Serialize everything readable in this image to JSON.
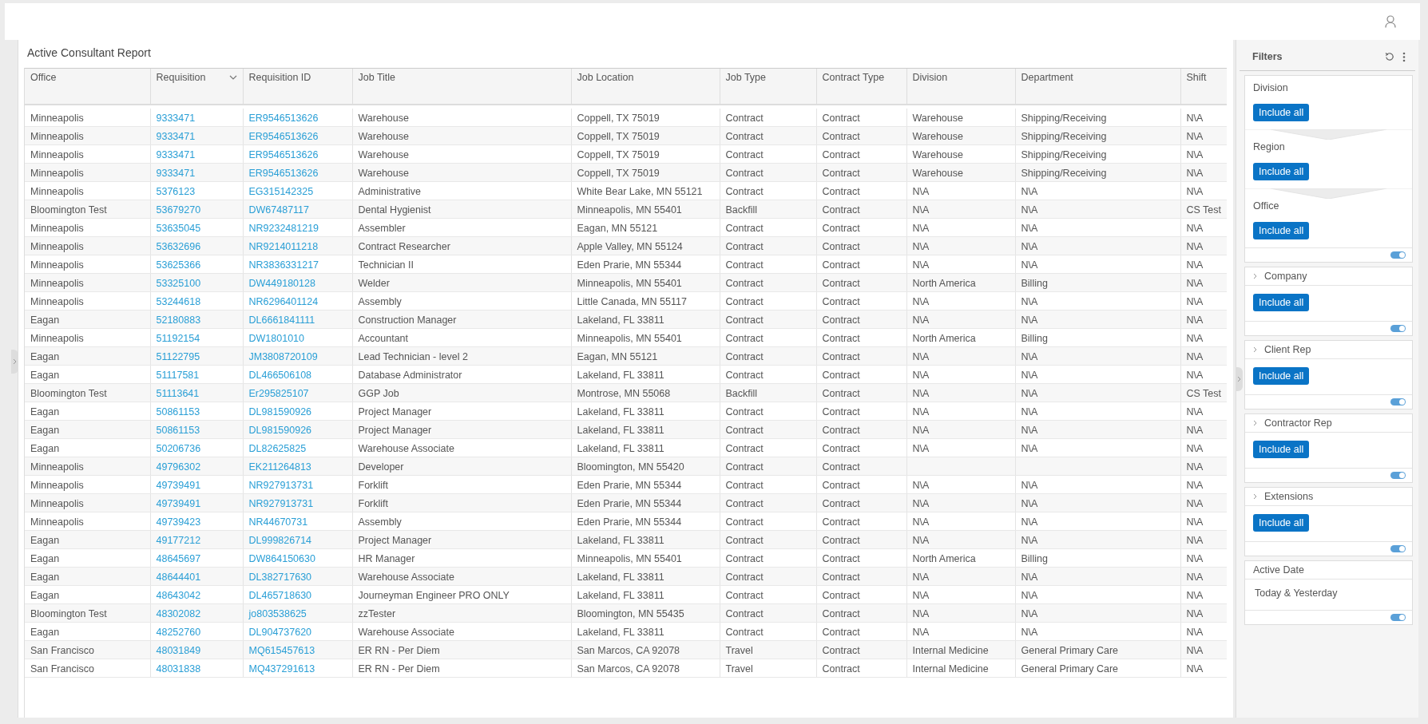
{
  "report": {
    "title": "Active Consultant Report",
    "columns": [
      {
        "label": "Office",
        "kind": "text",
        "sorted": false
      },
      {
        "label": "Requisition",
        "kind": "link",
        "sorted": true
      },
      {
        "label": "Requisition ID",
        "kind": "link",
        "sorted": false
      },
      {
        "label": "Job Title",
        "kind": "text",
        "sorted": false
      },
      {
        "label": "Job Location",
        "kind": "text",
        "sorted": false
      },
      {
        "label": "Job Type",
        "kind": "text",
        "sorted": false
      },
      {
        "label": "Contract Type",
        "kind": "text",
        "sorted": false
      },
      {
        "label": "Division",
        "kind": "text",
        "sorted": false
      },
      {
        "label": "Department",
        "kind": "text",
        "sorted": false
      },
      {
        "label": "Shift",
        "kind": "text",
        "sorted": false
      }
    ],
    "rows": [
      [
        "Minneapolis",
        "9333471",
        "ER9546513626",
        "Warehouse",
        "Coppell, TX 75019",
        "Contract",
        "Contract",
        "Warehouse",
        "Shipping/Receiving",
        "N\\A"
      ],
      [
        "Minneapolis",
        "9333471",
        "ER9546513626",
        "Warehouse",
        "Coppell, TX 75019",
        "Contract",
        "Contract",
        "Warehouse",
        "Shipping/Receiving",
        "N\\A"
      ],
      [
        "Minneapolis",
        "9333471",
        "ER9546513626",
        "Warehouse",
        "Coppell, TX 75019",
        "Contract",
        "Contract",
        "Warehouse",
        "Shipping/Receiving",
        "N\\A"
      ],
      [
        "Minneapolis",
        "9333471",
        "ER9546513626",
        "Warehouse",
        "Coppell, TX 75019",
        "Contract",
        "Contract",
        "Warehouse",
        "Shipping/Receiving",
        "N\\A"
      ],
      [
        "Minneapolis",
        "5376123",
        "EG315142325",
        "Administrative",
        "White Bear Lake, MN 55121",
        "Contract",
        "Contract",
        "N\\A",
        "N\\A",
        "N\\A"
      ],
      [
        "Bloomington Test",
        "53679270",
        "DW67487117",
        "Dental Hygienist",
        "Minneapolis, MN 55401",
        "Backfill",
        "Contract",
        "N\\A",
        "N\\A",
        "CS Test"
      ],
      [
        "Minneapolis",
        "53635045",
        "NR9232481219",
        "Assembler",
        "Eagan, MN 55121",
        "Contract",
        "Contract",
        "N\\A",
        "N\\A",
        "N\\A"
      ],
      [
        "Minneapolis",
        "53632696",
        "NR9214011218",
        "Contract Researcher",
        "Apple Valley, MN 55124",
        "Contract",
        "Contract",
        "N\\A",
        "N\\A",
        "N\\A"
      ],
      [
        "Minneapolis",
        "53625366",
        "NR3836331217",
        "Technician II",
        "Eden Prarie, MN 55344",
        "Contract",
        "Contract",
        "N\\A",
        "N\\A",
        "N\\A"
      ],
      [
        "Minneapolis",
        "53325100",
        "DW449180128",
        "Welder",
        "Minneapolis, MN 55401",
        "Contract",
        "Contract",
        "North America",
        "Billing",
        "N\\A"
      ],
      [
        "Minneapolis",
        "53244618",
        "NR6296401124",
        "Assembly",
        "Little Canada, MN 55117",
        "Contract",
        "Contract",
        "N\\A",
        "N\\A",
        "N\\A"
      ],
      [
        "Eagan",
        "52180883",
        "DL6661841111",
        "Construction Manager",
        "Lakeland, FL 33811",
        "Contract",
        "Contract",
        "N\\A",
        "N\\A",
        "N\\A"
      ],
      [
        "Minneapolis",
        "51192154",
        "DW1801010",
        "Accountant",
        "Minneapolis, MN 55401",
        "Contract",
        "Contract",
        "North America",
        "Billing",
        "N\\A"
      ],
      [
        "Eagan",
        "51122795",
        "JM3808720109",
        "Lead Technician - level 2",
        "Eagan, MN 55121",
        "Contract",
        "Contract",
        "N\\A",
        "N\\A",
        "N\\A"
      ],
      [
        "Eagan",
        "51117581",
        "DL466506108",
        "Database Administrator",
        "Lakeland, FL 33811",
        "Contract",
        "Contract",
        "N\\A",
        "N\\A",
        "N\\A"
      ],
      [
        "Bloomington Test",
        "51113641",
        "Er295825107",
        "GGP Job",
        "Montrose, MN 55068",
        "Backfill",
        "Contract",
        "N\\A",
        "N\\A",
        "CS Test"
      ],
      [
        "Eagan",
        "50861153",
        "DL981590926",
        "Project Manager",
        "Lakeland, FL 33811",
        "Contract",
        "Contract",
        "N\\A",
        "N\\A",
        "N\\A"
      ],
      [
        "Eagan",
        "50861153",
        "DL981590926",
        "Project Manager",
        "Lakeland, FL 33811",
        "Contract",
        "Contract",
        "N\\A",
        "N\\A",
        "N\\A"
      ],
      [
        "Eagan",
        "50206736",
        "DL82625825",
        "Warehouse Associate",
        "Lakeland, FL 33811",
        "Contract",
        "Contract",
        "N\\A",
        "N\\A",
        "N\\A"
      ],
      [
        "Minneapolis",
        "49796302",
        "EK211264813",
        "Developer",
        "Bloomington, MN 55420",
        "Contract",
        "Contract",
        "",
        "",
        "N\\A"
      ],
      [
        "Minneapolis",
        "49739491",
        "NR927913731",
        "Forklift",
        "Eden Prarie, MN 55344",
        "Contract",
        "Contract",
        "N\\A",
        "N\\A",
        "N\\A"
      ],
      [
        "Minneapolis",
        "49739491",
        "NR927913731",
        "Forklift",
        "Eden Prarie, MN 55344",
        "Contract",
        "Contract",
        "N\\A",
        "N\\A",
        "N\\A"
      ],
      [
        "Minneapolis",
        "49739423",
        "NR44670731",
        "Assembly",
        "Eden Prarie, MN 55344",
        "Contract",
        "Contract",
        "N\\A",
        "N\\A",
        "N\\A"
      ],
      [
        "Eagan",
        "49177212",
        "DL999826714",
        "Project Manager",
        "Lakeland, FL 33811",
        "Contract",
        "Contract",
        "N\\A",
        "N\\A",
        "N\\A"
      ],
      [
        "Eagan",
        "48645697",
        "DW864150630",
        "HR Manager",
        "Minneapolis, MN 55401",
        "Contract",
        "Contract",
        "North America",
        "Billing",
        "N\\A"
      ],
      [
        "Eagan",
        "48644401",
        "DL382717630",
        "Warehouse Associate",
        "Lakeland, FL 33811",
        "Contract",
        "Contract",
        "N\\A",
        "N\\A",
        "N\\A"
      ],
      [
        "Eagan",
        "48643042",
        "DL465718630",
        "Journeyman Engineer PRO ONLY",
        "Lakeland, FL 33811",
        "Contract",
        "Contract",
        "N\\A",
        "N\\A",
        "N\\A"
      ],
      [
        "Bloomington Test",
        "48302082",
        "jo803538625",
        "zzTester",
        "Bloomington, MN 55435",
        "Contract",
        "Contract",
        "N\\A",
        "N\\A",
        "N\\A"
      ],
      [
        "Eagan",
        "48252760",
        "DL904737620",
        "Warehouse Associate",
        "Lakeland, FL 33811",
        "Contract",
        "Contract",
        "N\\A",
        "N\\A",
        "N\\A"
      ],
      [
        "San Francisco",
        "48031849",
        "MQ615457613",
        "ER RN - Per Diem",
        "San Marcos, CA 92078",
        "Travel",
        "Contract",
        "Internal Medicine",
        "General Primary Care",
        "N\\A"
      ],
      [
        "San Francisco",
        "48031838",
        "MQ437291613",
        "ER RN - Per Diem",
        "San Marcos, CA 92078",
        "Travel",
        "Contract",
        "Internal Medicine",
        "General Primary Care",
        "N\\A"
      ]
    ]
  },
  "filters": {
    "title": "Filters",
    "groups": [
      {
        "kind": "cascade",
        "sections": [
          {
            "label": "Division",
            "button": "Include all"
          },
          {
            "label": "Region",
            "button": "Include all"
          },
          {
            "label": "Office",
            "button": "Include all"
          }
        ],
        "on": true
      },
      {
        "kind": "collapsible",
        "label": "Company",
        "button": "Include all",
        "on": true
      },
      {
        "kind": "collapsible",
        "label": "Client Rep",
        "button": "Include all",
        "on": true
      },
      {
        "kind": "collapsible",
        "label": "Contractor Rep",
        "button": "Include all",
        "on": true
      },
      {
        "kind": "collapsible",
        "label": "Extensions",
        "button": "Include all",
        "on": true
      },
      {
        "kind": "value",
        "label": "Active Date",
        "value": "Today & Yesterday",
        "on": true
      }
    ]
  }
}
